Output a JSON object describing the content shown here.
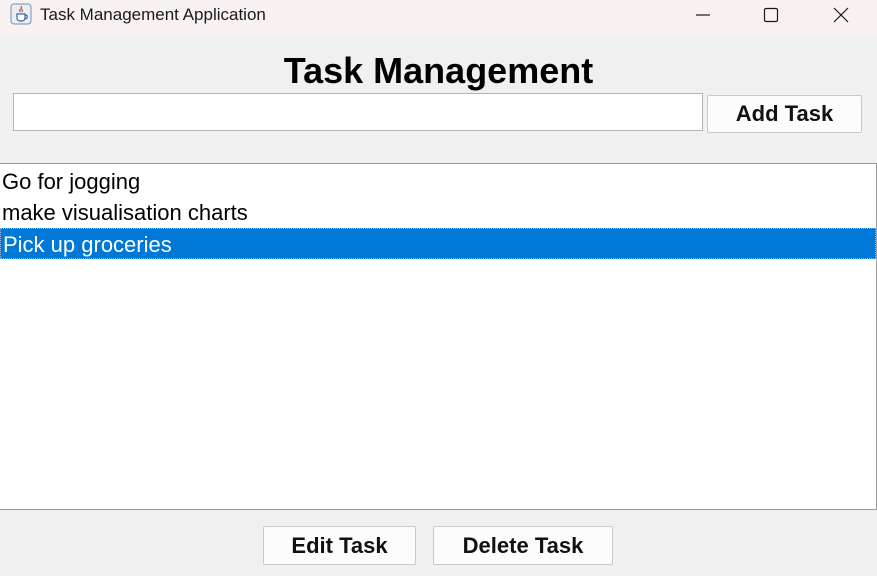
{
  "window": {
    "title": "Task Management Application",
    "icon": "java-cup-icon",
    "controls": [
      "minimize-icon",
      "maximize-icon",
      "close-icon"
    ]
  },
  "header": {
    "title": "Task Management"
  },
  "input": {
    "value": ""
  },
  "buttons": {
    "add": "Add Task",
    "edit": "Edit Task",
    "delete": "Delete Task"
  },
  "tasks": [
    {
      "label": "Go for jogging",
      "selected": false
    },
    {
      "label": "make visualisation charts",
      "selected": false
    },
    {
      "label": "Pick up groceries",
      "selected": true
    }
  ],
  "colors": {
    "selection": "#0078d7",
    "background": "#f0f0f0",
    "titlebar": "#f8f2f2"
  }
}
